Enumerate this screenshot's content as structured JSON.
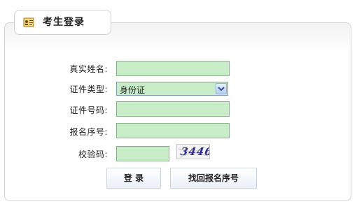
{
  "header": {
    "title": "考生登录"
  },
  "form": {
    "name_label": "真实姓名:",
    "name_value": "",
    "id_type_label": "证件类型:",
    "id_type_selected": "身份证",
    "id_number_label": "证件号码:",
    "id_number_value": "",
    "reg_number_label": "报名序号:",
    "reg_number_value": "",
    "captcha_label": "校验码:",
    "captcha_value": "",
    "captcha_image_text": "3446"
  },
  "buttons": {
    "login_label": "登 录",
    "recover_label": "找回报名序号"
  },
  "colors": {
    "input_bg": "#c8ecc8",
    "panel_border": "#d2d2d2"
  },
  "icons": [
    "id-card-icon",
    "chevron-down-icon"
  ]
}
